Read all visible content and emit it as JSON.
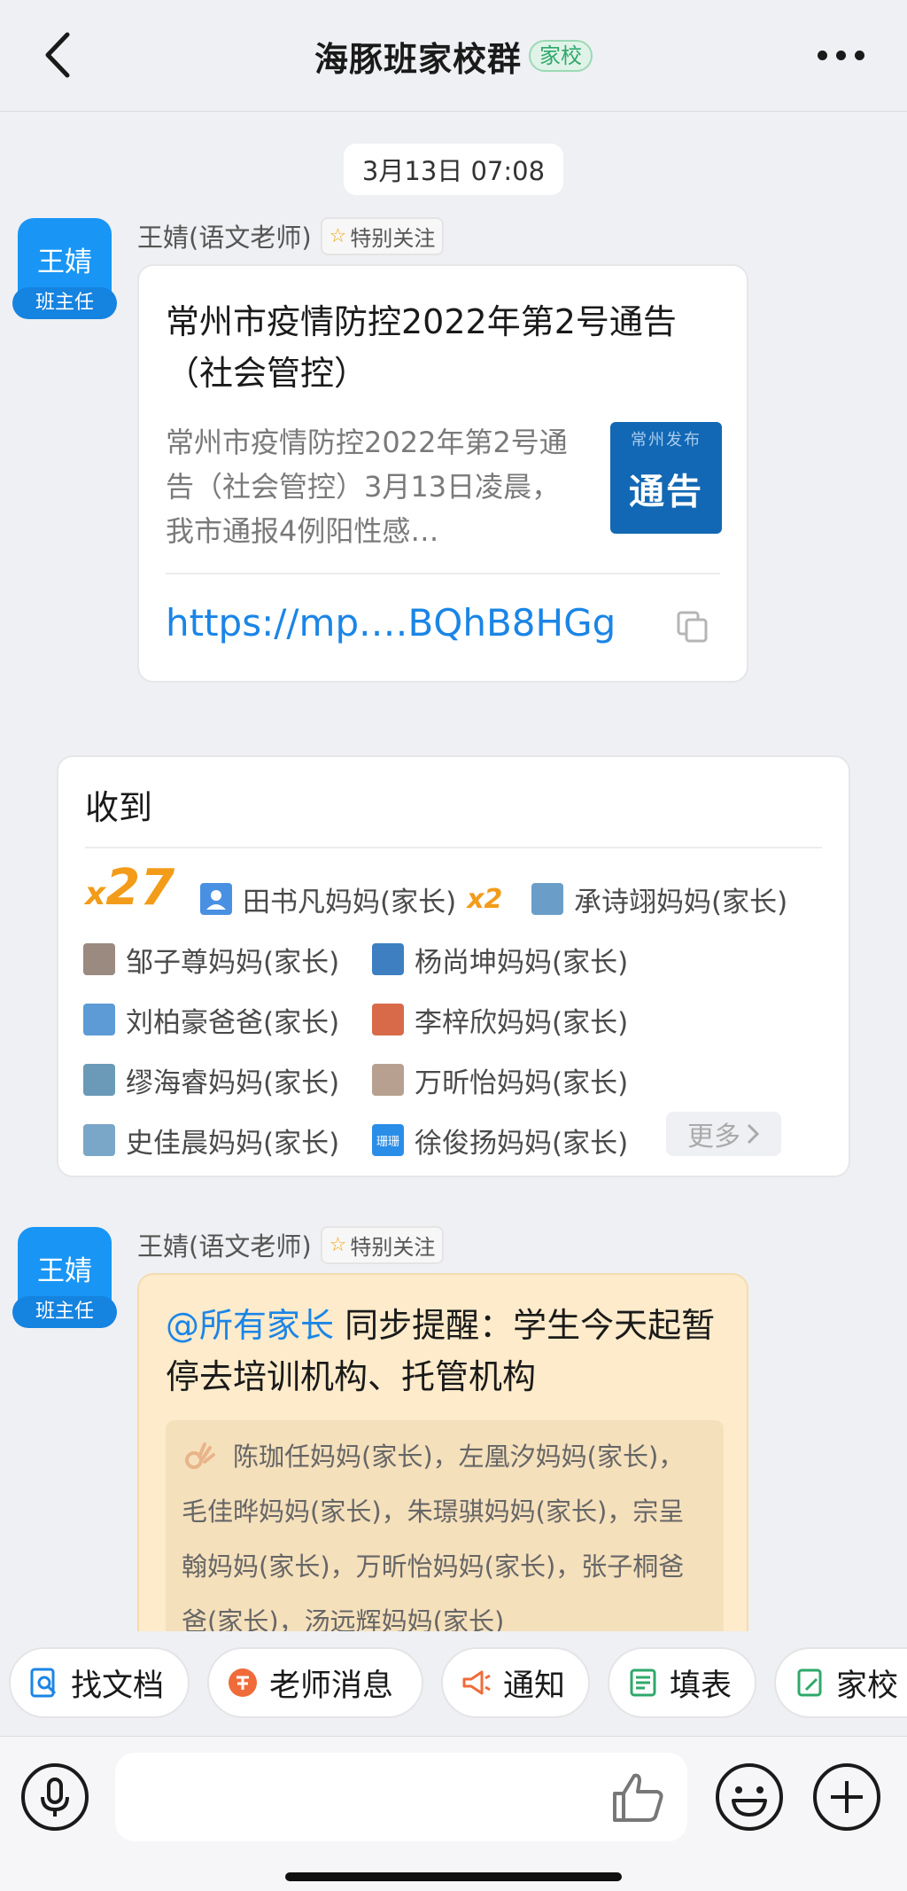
{
  "header": {
    "title": "海豚班家校群",
    "tag": "家校"
  },
  "timestamp": "3月13日 07:08",
  "messages": [
    {
      "avatar_name": "王婧",
      "avatar_role": "班主任",
      "sender": "王婧(语文老师)",
      "special_tag": "特别关注",
      "link_title": "常州市疫情防控2022年第2号通告（社会管控）",
      "link_desc": "常州市疫情防控2022年第2号通告（社会管控）3月13日凌晨，我市通报4例阳性感…",
      "thumb_top": "常州发布",
      "thumb_main": "通告",
      "link_url": "https://mp.…BQhB8HGg"
    },
    {
      "avatar_name": "王婧",
      "avatar_role": "班主任",
      "sender": "王婧(语文老师)",
      "special_tag": "特别关注",
      "mention": "@所有家长",
      "text": " 同步提醒：学生今天起暂停去培训机构、托管机构",
      "sub_text": "陈珈任妈妈(家长)，左凰汐妈妈(家长)，毛佳晔妈妈(家长)，朱璟骐妈妈(家长)，宗呈翰妈妈(家长)，万昕怡妈妈(家长)，张子桐爸爸(家长)，汤远辉妈妈(家长)"
    }
  ],
  "receipt": {
    "title": "收到",
    "count_prefix": "x",
    "count": "27",
    "parents": [
      {
        "name": "田书凡妈妈(家长)",
        "times": "x2",
        "avatar_color": "#4a90e2",
        "avatar_icon": "person-icon"
      },
      {
        "name": "承诗翊妈妈(家长)",
        "avatar_color": "#6a9ec9"
      },
      {
        "name": "邹子尊妈妈(家长)",
        "avatar_color": "#9a8a80"
      },
      {
        "name": "杨尚坤妈妈(家长)",
        "avatar_color": "#3d7fc0"
      },
      {
        "name": "刘柏豪爸爸(家长)",
        "avatar_color": "#5c9bd6"
      },
      {
        "name": "李梓欣妈妈(家长)",
        "avatar_color": "#d86a4a"
      },
      {
        "name": "缪海睿妈妈(家长)",
        "avatar_color": "#6a9ab8"
      },
      {
        "name": "万昕怡妈妈(家长)",
        "avatar_color": "#b8a090"
      },
      {
        "name": "史佳晨妈妈(家长)",
        "avatar_color": "#7aa6c8"
      },
      {
        "name": "徐俊扬妈妈(家长)",
        "avatar_color": "#2a8ee8",
        "avatar_text": "珊珊"
      }
    ],
    "more_label": "更多"
  },
  "quick_actions": [
    {
      "label": "找文档",
      "icon": "doc-search-icon",
      "color": "#1b85e6"
    },
    {
      "label": "老师消息",
      "icon": "teacher-icon",
      "color": "#f06b3a"
    },
    {
      "label": "通知",
      "icon": "megaphone-icon",
      "color": "#f06b3a"
    },
    {
      "label": "填表",
      "icon": "form-icon",
      "color": "#2fa86a"
    },
    {
      "label": "家校",
      "icon": "notebook-icon",
      "color": "#2fa86a"
    }
  ],
  "input": {
    "placeholder": ""
  },
  "colors": {
    "accent_blue": "#1b85e6",
    "avatar_blue": "#1996f5",
    "count_orange": "#f29c1a",
    "reminder_bg": "#fdebcb"
  }
}
